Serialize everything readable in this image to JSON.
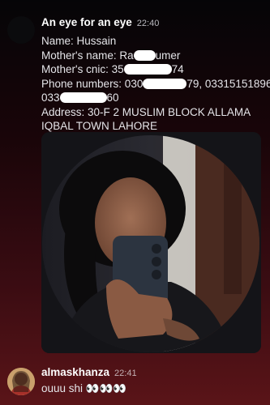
{
  "message": {
    "author": "An eye for an eye",
    "time": "22:40",
    "name_line": "Name: Hussain",
    "mother_name_prefix": "Mother's name: Ra",
    "mother_name_suffix": "umer",
    "mother_cnic_prefix": "Mother's cnic: 35",
    "mother_cnic_suffix": "74",
    "phone_prefix": "Phone numbers: 030",
    "phone_mid": "79, 03315151896,",
    "phone2_prefix": "033",
    "phone2_suffix": "60",
    "address": "Address: 30-F 2 MUSLIM BLOCK ALLAMA IQBAL TOWN LAHORE"
  },
  "reply": {
    "author": "almaskhanza",
    "time": "22:41",
    "text": "ouuu shi 👀👀👀"
  },
  "icons": {
    "author_avatar": "dark-circle-avatar",
    "attachment": "mirror-selfie-photo",
    "reply_avatar": "profile-photo-avatar"
  }
}
